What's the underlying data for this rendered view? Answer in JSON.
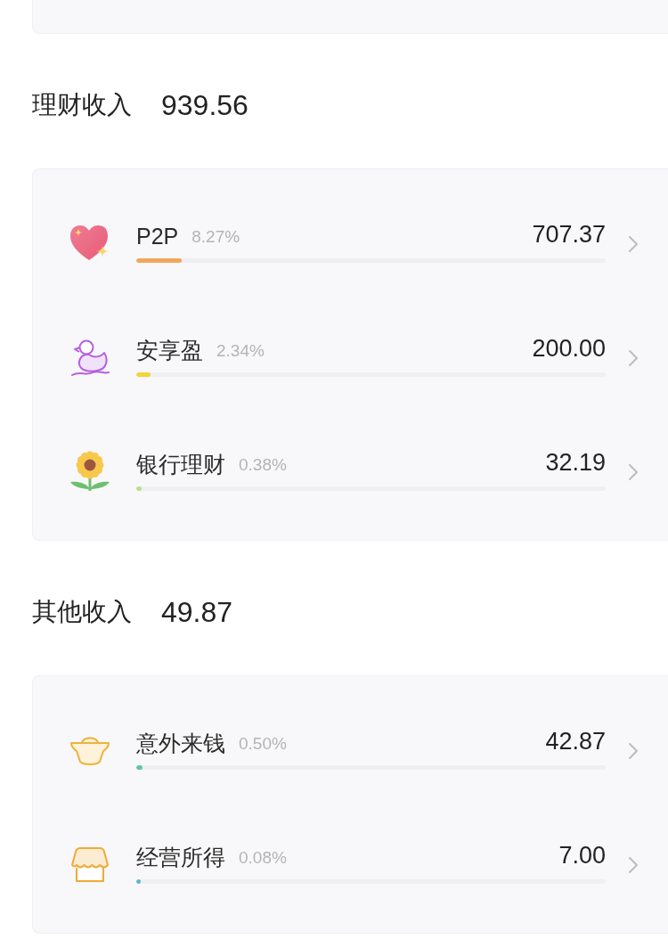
{
  "sections": [
    {
      "title": "理财收入",
      "total": "939.56",
      "items": [
        {
          "kind": "heart",
          "name": "P2P",
          "percent": "8.27%",
          "amount": "707.37",
          "level": 0.09,
          "color": "#f2a65a"
        },
        {
          "kind": "duck",
          "name": "安享盈",
          "percent": "2.34%",
          "amount": "200.00",
          "level": 0.023,
          "color": "#f5d33a"
        },
        {
          "kind": "sunflower",
          "name": "银行理财",
          "percent": "0.38%",
          "amount": "32.19",
          "level": 0.004,
          "color": "#b9e08c"
        }
      ]
    },
    {
      "title": "其他收入",
      "total": "49.87",
      "items": [
        {
          "kind": "ingot",
          "name": "意外来钱",
          "percent": "0.50%",
          "amount": "42.87",
          "level": 0.005,
          "color": "#5cc9a0"
        },
        {
          "kind": "shop",
          "name": "经营所得",
          "percent": "0.08%",
          "amount": "7.00",
          "level": 0.001,
          "color": "#5bb8c9"
        }
      ]
    }
  ]
}
